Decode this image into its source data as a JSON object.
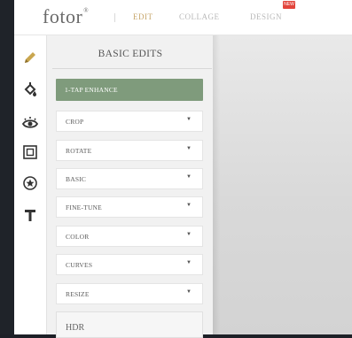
{
  "brand": {
    "logo": "fotor",
    "trademark": "®"
  },
  "nav": {
    "edit": "EDIT",
    "collage": "COLLAGE",
    "design": "DESIGN",
    "new_badge": "NEW"
  },
  "tools": [
    {
      "name": "pencil-icon"
    },
    {
      "name": "paint-bucket-icon"
    },
    {
      "name": "eye-icon"
    },
    {
      "name": "frame-icon"
    },
    {
      "name": "sticker-icon"
    },
    {
      "name": "text-icon"
    }
  ],
  "panel": {
    "title": "BASIC EDITS",
    "enhance": "1-TAP ENHANCE",
    "items": [
      {
        "label": "CROP"
      },
      {
        "label": "ROTATE"
      },
      {
        "label": "BASIC"
      },
      {
        "label": "FINE-TUNE"
      },
      {
        "label": "COLOR"
      },
      {
        "label": "CURVES"
      },
      {
        "label": "RESIZE"
      }
    ],
    "hdr": "HDR"
  },
  "colors": {
    "accent": "#c7a66b",
    "enhance_bg": "#7f9b7c",
    "badge": "#e2453c"
  }
}
